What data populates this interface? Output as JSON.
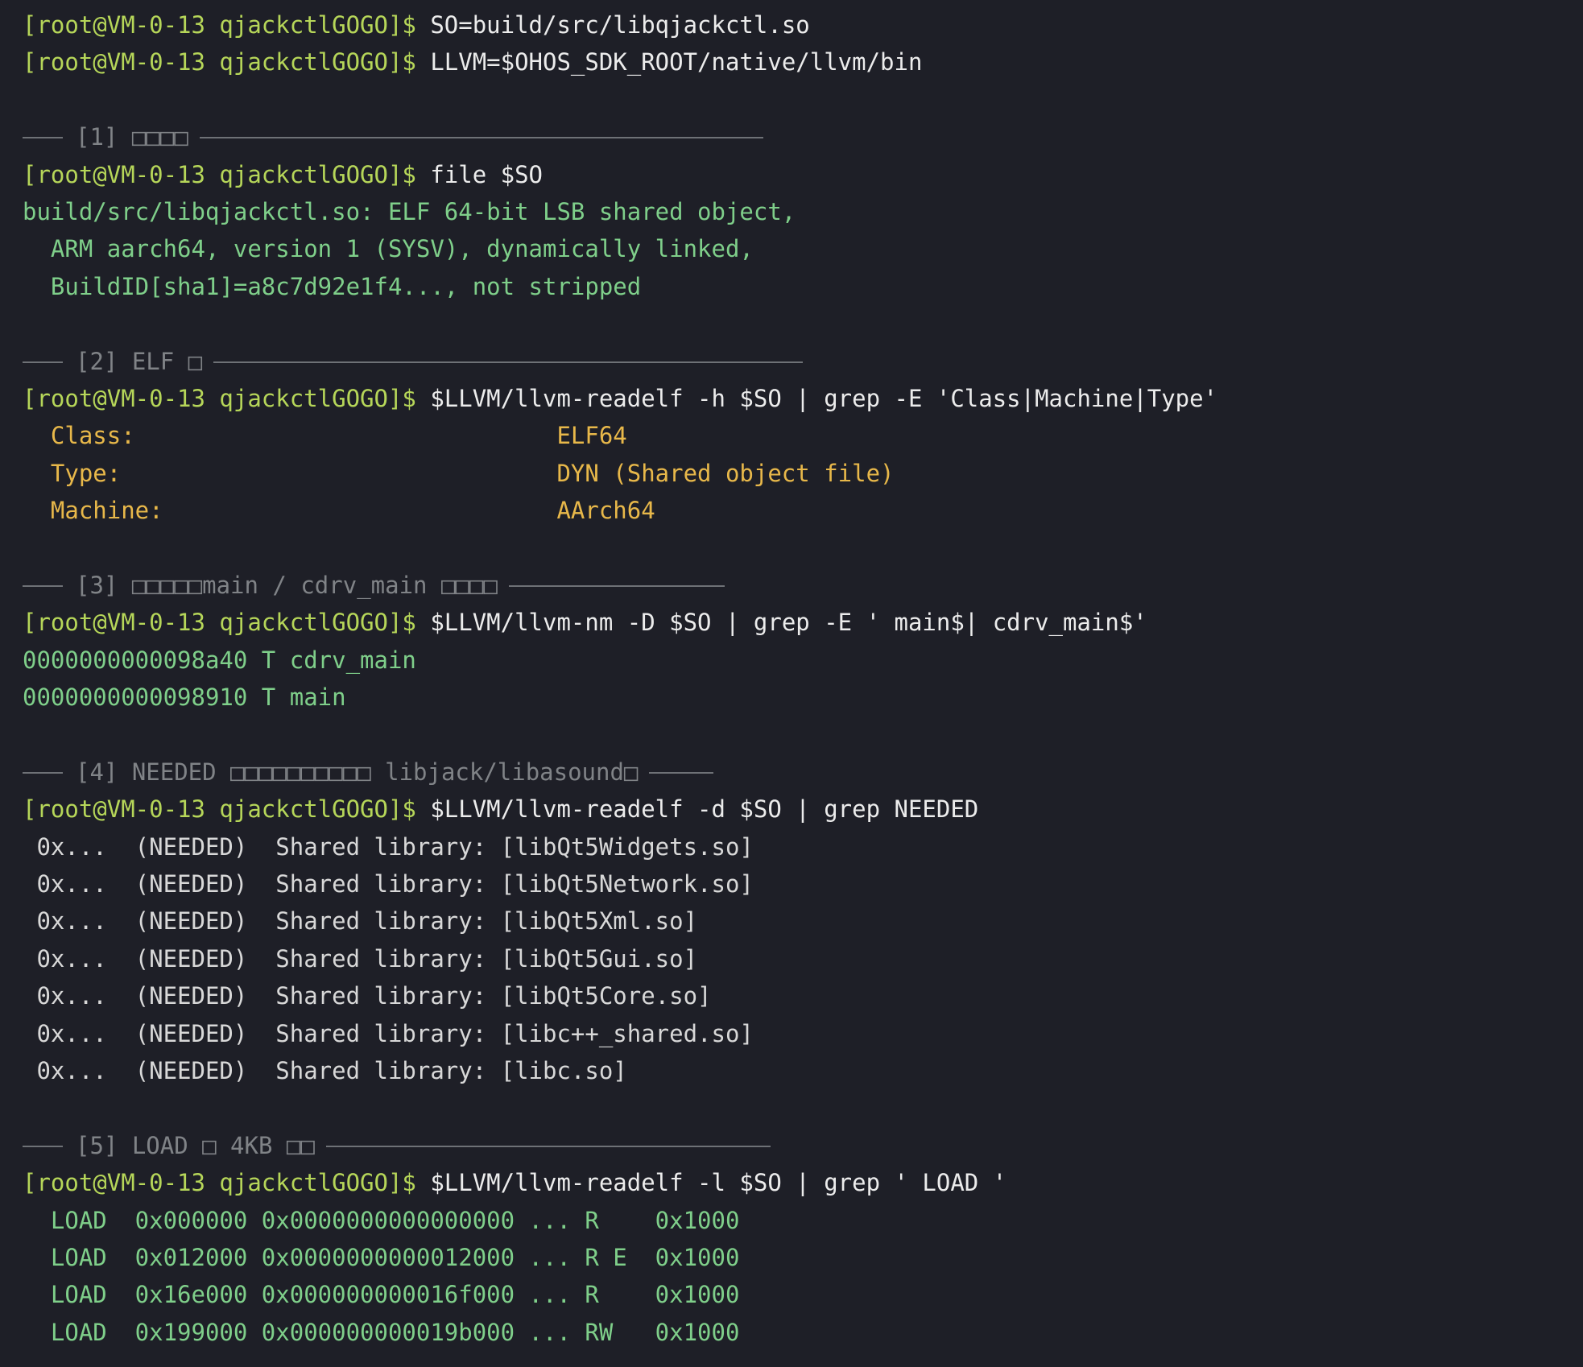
{
  "terminal": {
    "prompt": "[root@VM-0-13 qjackctlGOGO]$ ",
    "blocks": [
      {
        "type": "cmd",
        "text": "SO=build/src/libqjackctl.so"
      },
      {
        "type": "cmd",
        "text": "LLVM=$OHOS_SDK_ROOT/native/llvm/bin"
      },
      {
        "type": "blank"
      },
      {
        "type": "section",
        "text": "[1] □□□□",
        "rule": 700
      },
      {
        "type": "cmd",
        "text": "file $SO"
      },
      {
        "type": "out",
        "style": "green",
        "text": "build/src/libqjackctl.so: ELF 64-bit LSB shared object,"
      },
      {
        "type": "out",
        "style": "green",
        "text": "  ARM aarch64, version 1 (SYSV), dynamically linked,"
      },
      {
        "type": "out",
        "style": "green",
        "text": "  BuildID[sha1]=a8c7d92e1f4..., not stripped"
      },
      {
        "type": "blank"
      },
      {
        "type": "section",
        "text": "[2] ELF □",
        "rule": 732
      },
      {
        "type": "cmd",
        "text": "$LLVM/llvm-readelf -h $SO | grep -E 'Class|Machine|Type'"
      },
      {
        "type": "out",
        "style": "yellow",
        "text": "  Class:                              ELF64"
      },
      {
        "type": "out",
        "style": "yellow",
        "text": "  Type:                               DYN (Shared object file)"
      },
      {
        "type": "out",
        "style": "yellow",
        "text": "  Machine:                            AArch64"
      },
      {
        "type": "blank"
      },
      {
        "type": "section",
        "text": "[3] □□□□□main / cdrv_main □□□□",
        "rule": 268
      },
      {
        "type": "cmd",
        "text": "$LLVM/llvm-nm -D $SO | grep -E ' main$| cdrv_main$'"
      },
      {
        "type": "out",
        "style": "green",
        "text": "0000000000098a40 T cdrv_main"
      },
      {
        "type": "out",
        "style": "green",
        "text": "0000000000098910 T main"
      },
      {
        "type": "blank"
      },
      {
        "type": "section",
        "text": "[4] NEEDED □□□□□□□□□□ libjack/libasound□",
        "rule": 80
      },
      {
        "type": "cmd",
        "text": "$LLVM/llvm-readelf -d $SO | grep NEEDED"
      },
      {
        "type": "out",
        "style": "plain",
        "text": " 0x...  (NEEDED)  Shared library: [libQt5Widgets.so]"
      },
      {
        "type": "out",
        "style": "plain",
        "text": " 0x...  (NEEDED)  Shared library: [libQt5Network.so]"
      },
      {
        "type": "out",
        "style": "plain",
        "text": " 0x...  (NEEDED)  Shared library: [libQt5Xml.so]"
      },
      {
        "type": "out",
        "style": "plain",
        "text": " 0x...  (NEEDED)  Shared library: [libQt5Gui.so]"
      },
      {
        "type": "out",
        "style": "plain",
        "text": " 0x...  (NEEDED)  Shared library: [libQt5Core.so]"
      },
      {
        "type": "out",
        "style": "plain",
        "text": " 0x...  (NEEDED)  Shared library: [libc++_shared.so]"
      },
      {
        "type": "out",
        "style": "plain",
        "text": " 0x...  (NEEDED)  Shared library: [libc.so]"
      },
      {
        "type": "blank"
      },
      {
        "type": "section",
        "text": "[5] LOAD □ 4KB □□",
        "rule": 552
      },
      {
        "type": "cmd",
        "text": "$LLVM/llvm-readelf -l $SO | grep ' LOAD '"
      },
      {
        "type": "out",
        "style": "green",
        "text": "  LOAD  0x000000 0x0000000000000000 ... R    0x1000"
      },
      {
        "type": "out",
        "style": "green",
        "text": "  LOAD  0x012000 0x0000000000012000 ... R E  0x1000"
      },
      {
        "type": "out",
        "style": "green",
        "text": "  LOAD  0x16e000 0x000000000016f000 ... R    0x1000"
      },
      {
        "type": "out",
        "style": "green",
        "text": "  LOAD  0x199000 0x000000000019b000 ... RW   0x1000"
      }
    ]
  }
}
